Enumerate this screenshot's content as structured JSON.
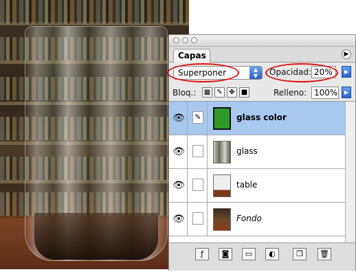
{
  "panel": {
    "tab_label": "Capas",
    "blend_mode": "Superponer",
    "opacity_label": "Opacidad:",
    "opacity_value": "20%",
    "lock_label": "Bloq.:",
    "fill_label": "Relleno:",
    "fill_value": "100%"
  },
  "layers": [
    {
      "name": "glass color",
      "selected": true
    },
    {
      "name": "glass",
      "selected": false
    },
    {
      "name": "table",
      "selected": false
    },
    {
      "name": "Fondo",
      "selected": false
    }
  ],
  "icons": {
    "eye": "eye-icon",
    "brush": "brush-icon",
    "lock": "lock-icon",
    "move": "move-icon",
    "trash": "trash-icon",
    "new_layer": "new-layer-icon",
    "folder": "folder-icon",
    "mask": "mask-icon",
    "styles": "layer-styles-icon",
    "adjust": "adjustment-layer-icon"
  },
  "colors": {
    "highlight": "#e01010",
    "selection": "#a8c8ee",
    "swatch_green": "#2f9a2a"
  }
}
